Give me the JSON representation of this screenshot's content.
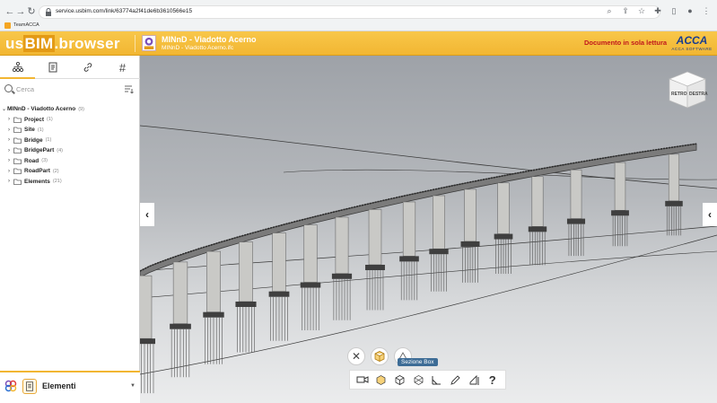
{
  "browser": {
    "url": "service.usbim.com/link/63774a2f41de6b3610566e15",
    "bookmark": "TeamACCA"
  },
  "header": {
    "logo_us": "us",
    "logo_bim": "BIM",
    "logo_browser": ".browser",
    "project_title": "MINnD - Viadotto Acerno",
    "project_subtitle": "MINnD - Viadotto Acerno.ifc",
    "readonly_label": "Documento in sola lettura",
    "brand": "ACCA",
    "brand_sub": "ACCA SOFTWARE"
  },
  "sidebar": {
    "tabs": [
      {
        "icon": "hierarchy-icon"
      },
      {
        "icon": "document-icon"
      },
      {
        "icon": "link-icon"
      },
      {
        "icon": "hash-icon"
      }
    ],
    "search_placeholder": "Cerca",
    "tree_root": {
      "label": "MINnD - Viadotto Acerno",
      "count": "(9)"
    },
    "tree_items": [
      {
        "label": "Project",
        "count": "(1)"
      },
      {
        "label": "Site",
        "count": "(1)"
      },
      {
        "label": "Bridge",
        "count": "(1)"
      },
      {
        "label": "BridgePart",
        "count": "(4)"
      },
      {
        "label": "Road",
        "count": "(3)"
      },
      {
        "label": "RoadPart",
        "count": "(2)"
      },
      {
        "label": "Elements",
        "count": "(21)"
      }
    ],
    "bottom_label": "Elementi"
  },
  "viewport": {
    "cube_labels": {
      "left": "RETRO",
      "right": "DESTRA"
    },
    "tooltip": "Sezione Box",
    "toolbar_help": "?"
  },
  "colors": {
    "accent": "#f2b632",
    "readonly": "#c0161c",
    "brand": "#1a3d8f",
    "tooltip": "#3d6c96"
  }
}
